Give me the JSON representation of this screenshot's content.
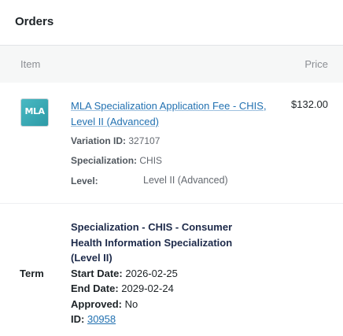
{
  "header": {
    "title": "Orders"
  },
  "table": {
    "col_item": "Item",
    "col_price": "Price"
  },
  "product": {
    "thumb_text": "MLA",
    "name": "MLA Specialization Application Fee - CHIS, Level II (Advanced)",
    "price": "$132.00",
    "variation_label": "Variation ID:",
    "variation_value": "327107",
    "specialization_label": "Specialization:",
    "specialization_value": "CHIS",
    "level_label": "Level:",
    "level_value": "Level II (Advanced)"
  },
  "term": {
    "label": "Term",
    "title": "Specialization - CHIS - Consumer Health Information Specialization (Level II)",
    "start_label": "Start Date:",
    "start_value": "2026-02-25",
    "end_label": "End Date:",
    "end_value": "2029-02-24",
    "approved_label": "Approved:",
    "approved_value": "No",
    "id_label": "ID:",
    "id_value": "30958"
  },
  "colors": {
    "link": "#2271b1",
    "thumb": "#3aa9b4",
    "header_bg": "#f6f7f7"
  }
}
